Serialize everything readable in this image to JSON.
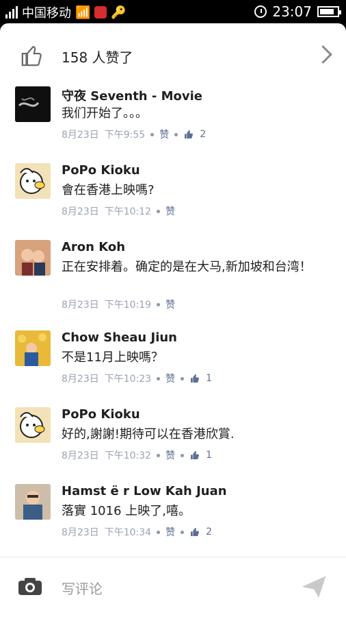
{
  "status": {
    "carrier": "中国移动",
    "time": "23:07",
    "battery_fraction": 0.85
  },
  "likes": {
    "label": "158 人赞了"
  },
  "comments": [
    {
      "name": "守夜 Seventh - Movie",
      "text": "我们开始了。。。",
      "date": "8月23日",
      "time": "下午9:55",
      "zan": "赞",
      "like_count": "2"
    },
    {
      "name": "PoPo Kioku",
      "text": "會在香港上映嗎?",
      "date": "8月23日",
      "time": "下午10:12",
      "zan": "赞",
      "like_count": null
    },
    {
      "name": "Aron Koh",
      "text": "正在安排着。确定的是在大马,新加坡和台湾！",
      "date": "8月23日",
      "time": "下午10:19",
      "zan": "赞",
      "like_count": null
    },
    {
      "name": "Chow Sheau Jiun",
      "text": "不是11月上映嗎？",
      "date": "8月23日",
      "time": "下午10:23",
      "zan": "赞",
      "like_count": "1"
    },
    {
      "name": "PoPo Kioku",
      "text": "好的,謝謝!期待可以在香港欣賞.",
      "date": "8月23日",
      "time": "下午10:32",
      "zan": "赞",
      "like_count": "1"
    },
    {
      "name": "Hamst ë r Low Kah Juan",
      "text": "落實 1016 上映了,嘻。",
      "date": "8月23日",
      "time": "下午10:34",
      "zan": "赞",
      "like_count": "2"
    }
  ],
  "composer": {
    "placeholder": "写评论"
  }
}
